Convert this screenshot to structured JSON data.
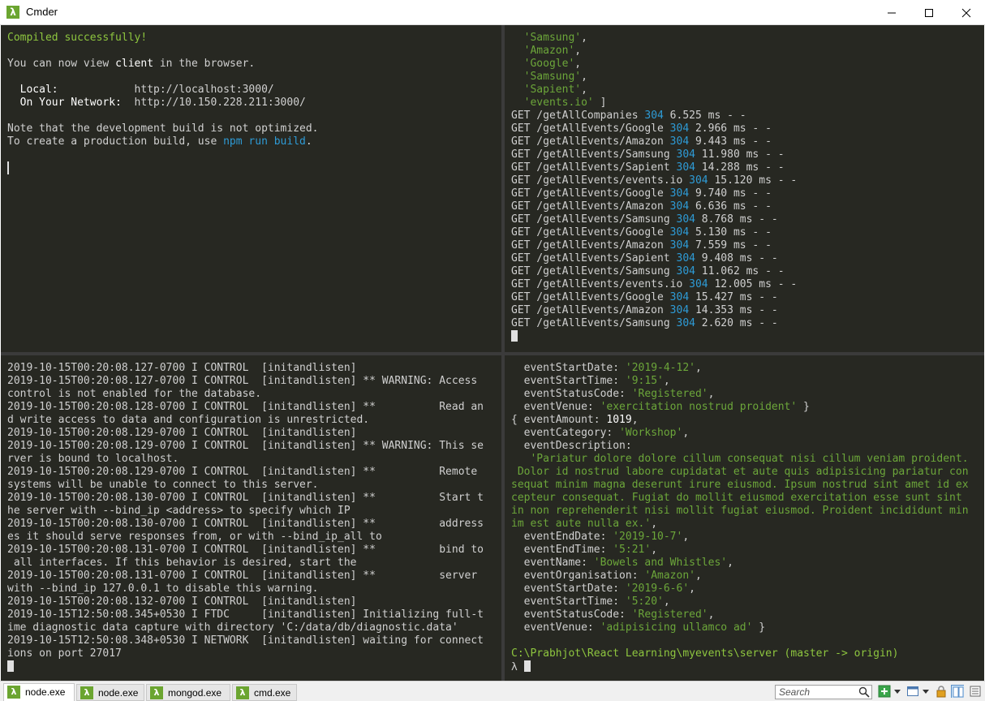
{
  "window": {
    "title": "Cmder",
    "app_icon": "λ"
  },
  "panes": {
    "top_left": [
      [
        {
          "t": "Compiled successfully!",
          "c": "green"
        }
      ],
      [
        {
          "t": ""
        }
      ],
      [
        {
          "t": "You can now view "
        },
        {
          "t": "client",
          "c": "white"
        },
        {
          "t": " in the browser."
        }
      ],
      [
        {
          "t": ""
        }
      ],
      [
        {
          "t": "  "
        },
        {
          "t": "Local:",
          "c": "white"
        },
        {
          "t": "            http://localhost:3000/"
        }
      ],
      [
        {
          "t": "  "
        },
        {
          "t": "On Your Network:",
          "c": "white"
        },
        {
          "t": "  http://10.150.228.211:3000/"
        }
      ],
      [
        {
          "t": ""
        }
      ],
      [
        {
          "t": "Note that the development build is not optimized."
        }
      ],
      [
        {
          "t": "To create a production build, use "
        },
        {
          "t": "npm run build",
          "c": "blue"
        },
        {
          "t": "."
        }
      ],
      [
        {
          "t": ""
        }
      ],
      [
        {
          "cursor": "thin"
        }
      ]
    ],
    "top_right": [
      [
        {
          "t": "  "
        },
        {
          "t": "'Samsung'",
          "c": "str"
        },
        {
          "t": ","
        }
      ],
      [
        {
          "t": "  "
        },
        {
          "t": "'Amazon'",
          "c": "str"
        },
        {
          "t": ","
        }
      ],
      [
        {
          "t": "  "
        },
        {
          "t": "'Google'",
          "c": "str"
        },
        {
          "t": ","
        }
      ],
      [
        {
          "t": "  "
        },
        {
          "t": "'Samsung'",
          "c": "str"
        },
        {
          "t": ","
        }
      ],
      [
        {
          "t": "  "
        },
        {
          "t": "'Sapient'",
          "c": "str"
        },
        {
          "t": ","
        }
      ],
      [
        {
          "t": "  "
        },
        {
          "t": "'events.io'",
          "c": "str"
        },
        {
          "t": " ]"
        }
      ],
      [
        {
          "t": "GET /getAllCompanies "
        },
        {
          "t": "304",
          "c": "blue"
        },
        {
          "t": " 6.525 ms - -"
        }
      ],
      [
        {
          "t": "GET /getAllEvents/Google "
        },
        {
          "t": "304",
          "c": "blue"
        },
        {
          "t": " 2.966 ms - -"
        }
      ],
      [
        {
          "t": "GET /getAllEvents/Amazon "
        },
        {
          "t": "304",
          "c": "blue"
        },
        {
          "t": " 9.443 ms - -"
        }
      ],
      [
        {
          "t": "GET /getAllEvents/Samsung "
        },
        {
          "t": "304",
          "c": "blue"
        },
        {
          "t": " 11.980 ms - -"
        }
      ],
      [
        {
          "t": "GET /getAllEvents/Sapient "
        },
        {
          "t": "304",
          "c": "blue"
        },
        {
          "t": " 14.288 ms - -"
        }
      ],
      [
        {
          "t": "GET /getAllEvents/events.io "
        },
        {
          "t": "304",
          "c": "blue"
        },
        {
          "t": " 15.120 ms - -"
        }
      ],
      [
        {
          "t": "GET /getAllEvents/Google "
        },
        {
          "t": "304",
          "c": "blue"
        },
        {
          "t": " 9.740 ms - -"
        }
      ],
      [
        {
          "t": "GET /getAllEvents/Amazon "
        },
        {
          "t": "304",
          "c": "blue"
        },
        {
          "t": " 6.636 ms - -"
        }
      ],
      [
        {
          "t": "GET /getAllEvents/Samsung "
        },
        {
          "t": "304",
          "c": "blue"
        },
        {
          "t": " 8.768 ms - -"
        }
      ],
      [
        {
          "t": "GET /getAllEvents/Google "
        },
        {
          "t": "304",
          "c": "blue"
        },
        {
          "t": " 5.130 ms - -"
        }
      ],
      [
        {
          "t": "GET /getAllEvents/Amazon "
        },
        {
          "t": "304",
          "c": "blue"
        },
        {
          "t": " 7.559 ms - -"
        }
      ],
      [
        {
          "t": "GET /getAllEvents/Sapient "
        },
        {
          "t": "304",
          "c": "blue"
        },
        {
          "t": " 9.408 ms - -"
        }
      ],
      [
        {
          "t": "GET /getAllEvents/Samsung "
        },
        {
          "t": "304",
          "c": "blue"
        },
        {
          "t": " 11.062 ms - -"
        }
      ],
      [
        {
          "t": "GET /getAllEvents/events.io "
        },
        {
          "t": "304",
          "c": "blue"
        },
        {
          "t": " 12.005 ms - -"
        }
      ],
      [
        {
          "t": "GET /getAllEvents/Google "
        },
        {
          "t": "304",
          "c": "blue"
        },
        {
          "t": " 15.427 ms - -"
        }
      ],
      [
        {
          "t": "GET /getAllEvents/Amazon "
        },
        {
          "t": "304",
          "c": "blue"
        },
        {
          "t": " 14.353 ms - -"
        }
      ],
      [
        {
          "t": "GET /getAllEvents/Samsung "
        },
        {
          "t": "304",
          "c": "blue"
        },
        {
          "t": " 2.620 ms - -"
        }
      ],
      [
        {
          "cursor": "block"
        }
      ]
    ],
    "bottom_left": [
      [
        {
          "t": "2019-10-15T00:20:08.127-0700 I CONTROL  [initandlisten]"
        }
      ],
      [
        {
          "t": "2019-10-15T00:20:08.127-0700 I CONTROL  [initandlisten] ** WARNING: Access"
        }
      ],
      [
        {
          "t": "control is not enabled for the database."
        }
      ],
      [
        {
          "t": "2019-10-15T00:20:08.128-0700 I CONTROL  [initandlisten] **          Read an"
        }
      ],
      [
        {
          "t": "d write access to data and configuration is unrestricted."
        }
      ],
      [
        {
          "t": "2019-10-15T00:20:08.129-0700 I CONTROL  [initandlisten]"
        }
      ],
      [
        {
          "t": "2019-10-15T00:20:08.129-0700 I CONTROL  [initandlisten] ** WARNING: This se"
        }
      ],
      [
        {
          "t": "rver is bound to localhost."
        }
      ],
      [
        {
          "t": "2019-10-15T00:20:08.129-0700 I CONTROL  [initandlisten] **          Remote"
        }
      ],
      [
        {
          "t": "systems will be unable to connect to this server."
        }
      ],
      [
        {
          "t": "2019-10-15T00:20:08.130-0700 I CONTROL  [initandlisten] **          Start t"
        }
      ],
      [
        {
          "t": "he server with --bind_ip <address> to specify which IP"
        }
      ],
      [
        {
          "t": "2019-10-15T00:20:08.130-0700 I CONTROL  [initandlisten] **          address"
        }
      ],
      [
        {
          "t": "es it should serve responses from, or with --bind_ip_all to"
        }
      ],
      [
        {
          "t": "2019-10-15T00:20:08.131-0700 I CONTROL  [initandlisten] **          bind to"
        }
      ],
      [
        {
          "t": " all interfaces. If this behavior is desired, start the"
        }
      ],
      [
        {
          "t": "2019-10-15T00:20:08.131-0700 I CONTROL  [initandlisten] **          server"
        }
      ],
      [
        {
          "t": "with --bind_ip 127.0.0.1 to disable this warning."
        }
      ],
      [
        {
          "t": "2019-10-15T00:20:08.132-0700 I CONTROL  [initandlisten]"
        }
      ],
      [
        {
          "t": "2019-10-15T12:50:08.345+0530 I FTDC     [initandlisten] Initializing full-t"
        }
      ],
      [
        {
          "t": "ime diagnostic data capture with directory 'C:/data/db/diagnostic.data'"
        }
      ],
      [
        {
          "t": "2019-10-15T12:50:08.348+0530 I NETWORK  [initandlisten] waiting for connect"
        }
      ],
      [
        {
          "t": "ions on port 27017"
        }
      ],
      [
        {
          "cursor": "block"
        }
      ]
    ],
    "bottom_right": [
      [
        {
          "t": "  eventStartDate: "
        },
        {
          "t": "'2019-4-12'",
          "c": "str"
        },
        {
          "t": ","
        }
      ],
      [
        {
          "t": "  eventStartTime: "
        },
        {
          "t": "'9:15'",
          "c": "str"
        },
        {
          "t": ","
        }
      ],
      [
        {
          "t": "  eventStatusCode: "
        },
        {
          "t": "'Registered'",
          "c": "str"
        },
        {
          "t": ","
        }
      ],
      [
        {
          "t": "  eventVenue: "
        },
        {
          "t": "'exercitation nostrud proident'",
          "c": "str"
        },
        {
          "t": " }"
        }
      ],
      [
        {
          "t": "{ eventAmount: "
        },
        {
          "t": "1019",
          "c": "white"
        },
        {
          "t": ","
        }
      ],
      [
        {
          "t": "  eventCategory: "
        },
        {
          "t": "'Workshop'",
          "c": "str"
        },
        {
          "t": ","
        }
      ],
      [
        {
          "t": "  eventDescription:"
        }
      ],
      [
        {
          "t": "   'Pariatur dolore dolore cillum consequat nisi cillum veniam proident.",
          "c": "str"
        }
      ],
      [
        {
          "t": " Dolor id nostrud labore cupidatat et aute quis adipisicing pariatur con",
          "c": "str"
        }
      ],
      [
        {
          "t": "sequat minim magna deserunt irure eiusmod. Ipsum nostrud sint amet id ex",
          "c": "str"
        }
      ],
      [
        {
          "t": "cepteur consequat. Fugiat do mollit eiusmod exercitation esse sunt sint",
          "c": "str"
        }
      ],
      [
        {
          "t": "in non reprehenderit nisi mollit fugiat eiusmod. Proident incididunt min",
          "c": "str"
        }
      ],
      [
        {
          "t": "im est aute nulla ex.'",
          "c": "str"
        },
        {
          "t": ","
        }
      ],
      [
        {
          "t": "  eventEndDate: "
        },
        {
          "t": "'2019-10-7'",
          "c": "str"
        },
        {
          "t": ","
        }
      ],
      [
        {
          "t": "  eventEndTime: "
        },
        {
          "t": "'5:21'",
          "c": "str"
        },
        {
          "t": ","
        }
      ],
      [
        {
          "t": "  eventName: "
        },
        {
          "t": "'Bowels and Whistles'",
          "c": "str"
        },
        {
          "t": ","
        }
      ],
      [
        {
          "t": "  eventOrganisation: "
        },
        {
          "t": "'Amazon'",
          "c": "str"
        },
        {
          "t": ","
        }
      ],
      [
        {
          "t": "  eventStartDate: "
        },
        {
          "t": "'2019-6-6'",
          "c": "str"
        },
        {
          "t": ","
        }
      ],
      [
        {
          "t": "  eventStartTime: "
        },
        {
          "t": "'5:20'",
          "c": "str"
        },
        {
          "t": ","
        }
      ],
      [
        {
          "t": "  eventStatusCode: "
        },
        {
          "t": "'Registered'",
          "c": "str"
        },
        {
          "t": ","
        }
      ],
      [
        {
          "t": "  eventVenue: "
        },
        {
          "t": "'adipisicing ullamco ad'",
          "c": "str"
        },
        {
          "t": " }"
        }
      ],
      [
        {
          "t": ""
        }
      ],
      [
        {
          "t": "C:\\Prabhjot\\React Learning\\myevents\\server (master -> origin)",
          "c": "green"
        }
      ],
      [
        {
          "t": "λ "
        },
        {
          "cursor": "block"
        }
      ]
    ]
  },
  "tabs": [
    {
      "label": "node.exe",
      "active": true
    },
    {
      "label": "node.exe",
      "active": false
    },
    {
      "label": "mongod.exe",
      "active": false
    },
    {
      "label": "cmd.exe",
      "active": false
    }
  ],
  "toolbar": {
    "search_placeholder": "Search",
    "icons": [
      "search-icon",
      "new-tab-plus-icon",
      "dropdown-arrow-icon",
      "layout-icon",
      "dropdown-arrow-icon",
      "lock-icon",
      "split-view-icon",
      "menu-icon"
    ]
  },
  "colors": {
    "terminal_bg": "#272822",
    "text": "#d0d0d0",
    "green": "#8ec63f",
    "string": "#6ca63a",
    "blue": "#2e9bd6",
    "cmder_green": "#6ba530"
  }
}
